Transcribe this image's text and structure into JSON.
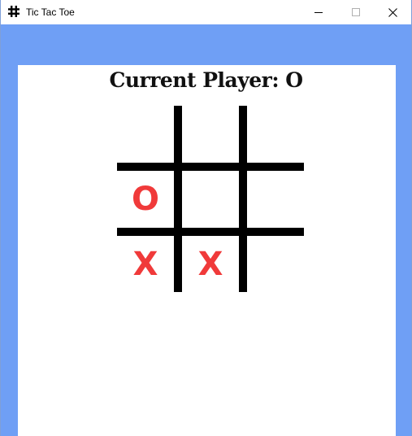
{
  "window": {
    "title": "Tic Tac Toe",
    "icon": "hash-icon",
    "controls": [
      "minimize-icon",
      "maximize-icon",
      "close-icon"
    ]
  },
  "game": {
    "status": "Current Player: O",
    "cells": [
      "",
      "",
      "",
      "O",
      "",
      "",
      "X",
      "X",
      ""
    ]
  },
  "colors": {
    "frame_background": "#6f9ff5",
    "canvas_background": "#ffffff",
    "grid_lines": "#000000",
    "marks": "#f03a3a"
  }
}
